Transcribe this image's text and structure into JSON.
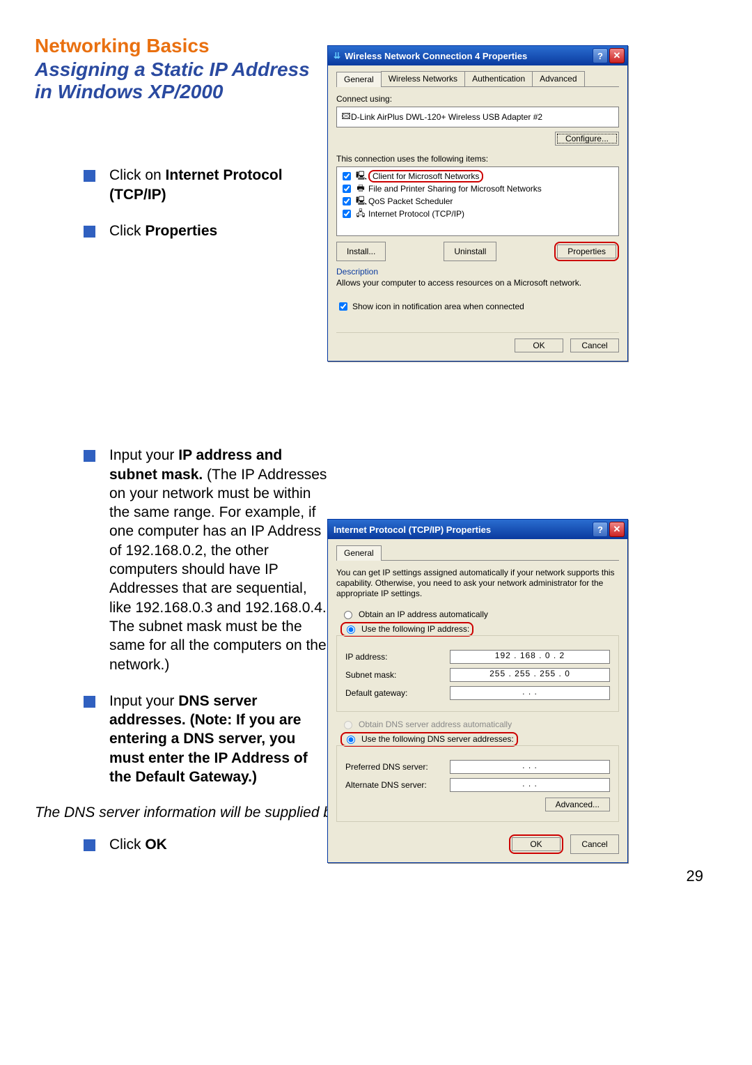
{
  "page": {
    "title_main": "Networking Basics",
    "title_sub": "Assigning a Static IP Address in Windows XP/2000",
    "page_number": "29",
    "bullets_top": [
      {
        "prefix": "Click on ",
        "bold": "Internet Protocol (TCP/IP)"
      },
      {
        "prefix": "Click ",
        "bold": "Properties"
      }
    ],
    "bullet_ip": {
      "prefix": "Input your ",
      "bold1": "IP address and subnet mask.",
      "rest": " (The IP Addresses on your network must be within the same range. For example, if one computer has an IP Address of 192.168.0.2, the other computers should have IP Addresses that are sequential, like 192.168.0.3 and 192.168.0.4.  The subnet mask must be the same for all the computers on the network.)"
    },
    "bullet_dns": {
      "prefix": "Input your ",
      "bold1": "DNS server addresses.  (Note:  If you are entering a DNS server, you must enter the IP Address of the Default Gateway.)"
    },
    "italics_note": "The DNS server information will be supplied by your ISP (Internet Service Provider.)",
    "bullet_ok": {
      "prefix": "Click ",
      "bold": "OK"
    }
  },
  "dialog1": {
    "title": "Wireless Network Connection 4 Properties",
    "tabs": [
      "General",
      "Wireless Networks",
      "Authentication",
      "Advanced"
    ],
    "connect_using_label": "Connect using:",
    "adapter": "D-Link AirPlus DWL-120+ Wireless USB Adapter #2",
    "configure_btn": "Configure...",
    "uses_items_label": "This connection uses the following items:",
    "items": [
      "Client for Microsoft Networks",
      "File and Printer Sharing for Microsoft Networks",
      "QoS Packet Scheduler",
      "Internet Protocol (TCP/IP)"
    ],
    "install_btn": "Install...",
    "uninstall_btn": "Uninstall",
    "properties_btn": "Properties",
    "description_label": "Description",
    "description_text": "Allows your computer to access resources on a Microsoft network.",
    "show_icon_label": "Show icon in notification area when connected",
    "ok_btn": "OK",
    "cancel_btn": "Cancel"
  },
  "dialog2": {
    "title": "Internet Protocol (TCP/IP) Properties",
    "tabs": [
      "General"
    ],
    "info_text": "You can get IP settings assigned automatically if your network supports this capability. Otherwise, you need to ask your network administrator for the appropriate IP settings.",
    "radio_auto_ip": "Obtain an IP address automatically",
    "radio_use_ip": "Use the following IP address:",
    "ip_label": "IP address:",
    "ip_value": "192 . 168 .  0  .  2",
    "subnet_label": "Subnet mask:",
    "subnet_value": "255 . 255 . 255 .  0",
    "gateway_label": "Default gateway:",
    "gateway_value": " .       .       . ",
    "radio_auto_dns": "Obtain DNS server address automatically",
    "radio_use_dns": "Use the following DNS server addresses:",
    "pref_dns_label": "Preferred DNS server:",
    "pref_dns_value": " .       .       . ",
    "alt_dns_label": "Alternate DNS server:",
    "alt_dns_value": " .       .       . ",
    "advanced_btn": "Advanced...",
    "ok_btn": "OK",
    "cancel_btn": "Cancel"
  }
}
